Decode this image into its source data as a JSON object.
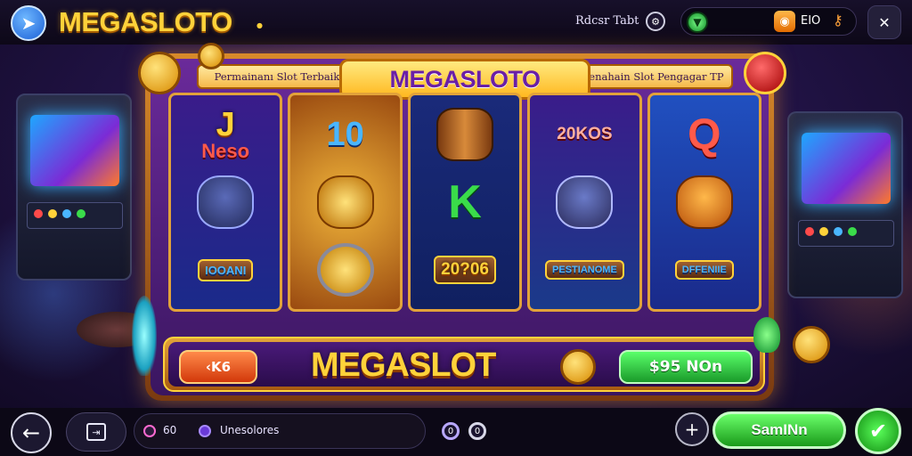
{
  "topbar": {
    "brand": "MEGASLOTO",
    "brand_suffix": "●",
    "label": "Rdcsr Tabt",
    "balance_value": "EIO",
    "coin_badge": "◉",
    "icons": [
      "paper-plane-icon",
      "settings-icon",
      "gem-icon",
      "coin-icon",
      "key-icon",
      "close-icon"
    ]
  },
  "machine": {
    "title": "MEGASLOTO",
    "left_banner": "Permainanı Slot Terbaik",
    "right_banner": "Senahain Slot Pengagar TP",
    "reels": [
      {
        "symbols": [
          "J Neso",
          "wolf-character",
          "IOOANI"
        ]
      },
      {
        "symbols": [
          "10",
          "golden-trophy",
          "gold-coin-emblem"
        ]
      },
      {
        "symbols": [
          "barrel",
          "K",
          "20?06"
        ]
      },
      {
        "symbols": [
          "20KOS",
          "wolf-character",
          "PESTIANOME"
        ]
      },
      {
        "symbols": [
          "Q",
          "cowboy-character",
          "DFFENIIE"
        ]
      }
    ],
    "reel_labels": {
      "r1_top_a": "J",
      "r1_top_b": "Neso",
      "r1_bottom": "IOOANI",
      "r2_top": "10",
      "r3_mid": "K",
      "r3_bottom": "20?06",
      "r4_top": "20KOS",
      "r4_bottom": "PESTIANOME",
      "r5_top": "Q",
      "r5_bottom": "DFFENIIE"
    },
    "panel": {
      "minus_label": "‹K6",
      "title": "MEGASLOT",
      "spin_label": "$95 NOn"
    }
  },
  "bottombar": {
    "pill_number": "60",
    "pill_text": "Unesolores",
    "ring1": "0",
    "ring2": "0",
    "start_label": "SamINn",
    "icons": [
      "back-arrow-icon",
      "menu-box-icon",
      "plus-icon",
      "checkmark-icon"
    ]
  },
  "colors": {
    "brand_gold": "#ffd23a",
    "machine_purple": "#6a2a9a",
    "spin_green": "#1a9a2a",
    "minus_orange": "#d2380a"
  }
}
